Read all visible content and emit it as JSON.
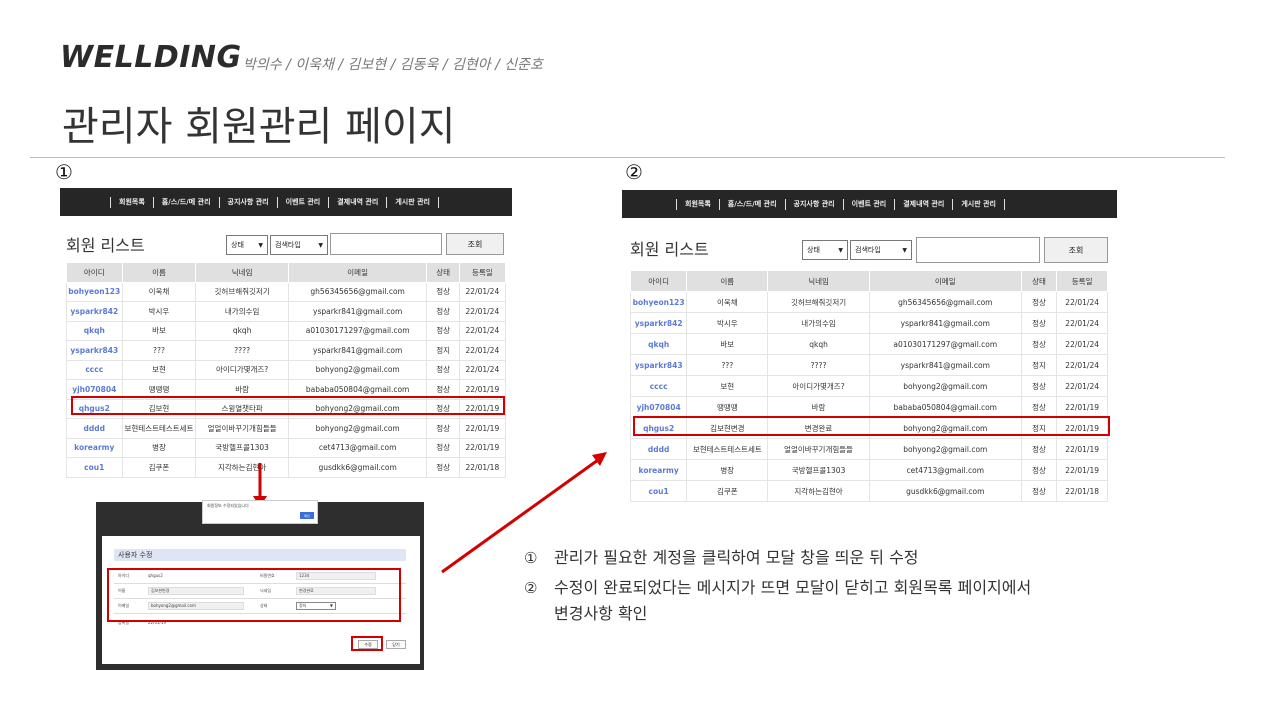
{
  "brand": "WELLDING",
  "team": "박의수 / 이욱채 / 김보현 / 김동욱 / 김현아 / 신준호",
  "slide_title": "관리자 회원관리 페이지",
  "step1": "①",
  "step2": "②",
  "nav": [
    "회원목록",
    "홈/스/드/메 관리",
    "공지사항 관리",
    "이벤트 관리",
    "결제내역 관리",
    "게시판 관리"
  ],
  "list_title": "회원 리스트",
  "filter": {
    "status": "상태",
    "search_type": "검색타입",
    "search_button": "조회"
  },
  "columns": [
    "아이디",
    "이름",
    "닉네임",
    "이메일",
    "상태",
    "등록일"
  ],
  "rows_before": [
    [
      "bohyeon123",
      "이욱채",
      "깃허브해줘깃저기",
      "gh56345656@gmail.com",
      "정상",
      "22/01/24"
    ],
    [
      "ysparkr842",
      "박시우",
      "내가의수임",
      "ysparkr841@gmail.com",
      "정상",
      "22/01/24"
    ],
    [
      "qkqh",
      "바보",
      "qkqh",
      "a01030171297@gmail.com",
      "정상",
      "22/01/24"
    ],
    [
      "ysparkr843",
      "???",
      "????",
      "ysparkr841@gmail.com",
      "정지",
      "22/01/24"
    ],
    [
      "cccc",
      "보현",
      "아이디가몇개즈?",
      "bohyong2@gmail.com",
      "정상",
      "22/01/24"
    ],
    [
      "yjh070804",
      "땡땡땡",
      "바람",
      "bababa050804@gmail.com",
      "정상",
      "22/01/19"
    ],
    [
      "qhgus2",
      "김보현",
      "스윙열챗타파",
      "bohyong2@gmail.com",
      "정상",
      "22/01/19"
    ],
    [
      "dddd",
      "보현테스트테스트세트",
      "얼얼이바꾸기개힘들들",
      "bohyong2@gmail.com",
      "정상",
      "22/01/19"
    ],
    [
      "korearmy",
      "병장",
      "국방헬프콜1303",
      "cet4713@gmail.com",
      "정상",
      "22/01/19"
    ],
    [
      "cou1",
      "김쿠폰",
      "지각하는김현아",
      "gusdkk6@gmail.com",
      "정상",
      "22/01/18"
    ]
  ],
  "rows_after": [
    [
      "bohyeon123",
      "이욱채",
      "깃허브해줘깃저기",
      "gh56345656@gmail.com",
      "정상",
      "22/01/24"
    ],
    [
      "ysparkr842",
      "박시우",
      "내가의수임",
      "ysparkr841@gmail.com",
      "정상",
      "22/01/24"
    ],
    [
      "qkqh",
      "바보",
      "qkqh",
      "a01030171297@gmail.com",
      "정상",
      "22/01/24"
    ],
    [
      "ysparkr843",
      "???",
      "????",
      "ysparkr841@gmail.com",
      "정지",
      "22/01/24"
    ],
    [
      "cccc",
      "보현",
      "아이디가몇개즈?",
      "bohyong2@gmail.com",
      "정상",
      "22/01/24"
    ],
    [
      "yjh070804",
      "땡땡땡",
      "바람",
      "bababa050804@gmail.com",
      "정상",
      "22/01/19"
    ],
    [
      "qhgus2",
      "김보현변경",
      "변경완료",
      "bohyong2@gmail.com",
      "정지",
      "22/01/19"
    ],
    [
      "dddd",
      "보현테스트테스트세트",
      "얼얼이바꾸기개힘들들",
      "bohyong2@gmail.com",
      "정상",
      "22/01/19"
    ],
    [
      "korearmy",
      "병장",
      "국방헬프콜1303",
      "cet4713@gmail.com",
      "정상",
      "22/01/19"
    ],
    [
      "cou1",
      "김쿠폰",
      "지각하는김현아",
      "gusdkk6@gmail.com",
      "정상",
      "22/01/18"
    ]
  ],
  "alert": {
    "message": "회원정보 수정되었습니다",
    "ok": "확인"
  },
  "modal": {
    "title": "사용자 수정",
    "id_label": "아이디",
    "id_value": "qhgus2",
    "pw_label": "비밀번호",
    "pw_value": "1234",
    "name_label": "이름",
    "name_value": "김보현변경",
    "nick_label": "닉네임",
    "nick_value": "변경완료",
    "email_label": "이메일",
    "email_value": "bohyong2@gmail.com",
    "status_label": "상태",
    "status_value": "정지",
    "reg_label": "등록일",
    "reg_value": "22/01/19",
    "save": "수정",
    "close": "닫기"
  },
  "explain": {
    "mark1": "①",
    "text1": "관리가 필요한 계정을 클릭하여 모달 창을 띄운 뒤 수정",
    "mark2": "②",
    "text2": "수정이 완료되었다는 메시지가 뜨면 모달이 닫히고 회원목록 페이지에서",
    "text3": "변경사항 확인"
  },
  "colors": {
    "highlight": "#d40000",
    "navbar": "#262626",
    "uid": "#5b7bd5",
    "header_row": "#e0e0e0"
  }
}
